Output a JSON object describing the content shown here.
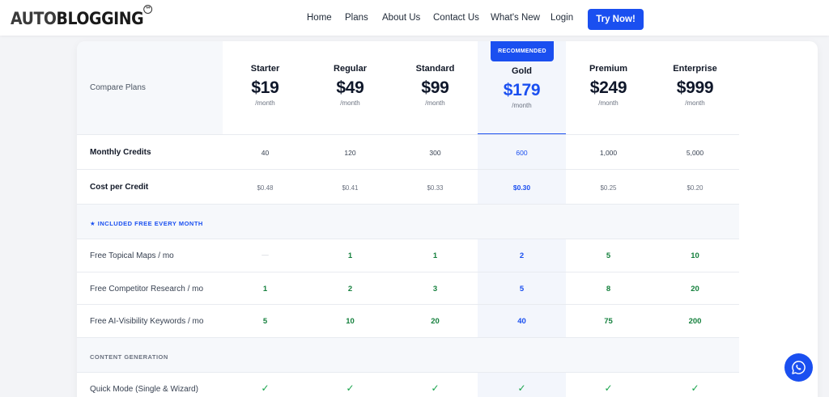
{
  "header": {
    "logo_auto": "AUTO",
    "logo_blogging": "BLOGGING",
    "logo_tm": "TM",
    "nav": [
      "Home",
      "Plans",
      "About Us",
      "Contact Us",
      "What's New",
      "Login"
    ],
    "cta": "Try Now!"
  },
  "table": {
    "compare_label": "Compare Plans",
    "badge": "RECOMMENDED",
    "plans": [
      {
        "name": "Starter",
        "price": "$19",
        "per": "/month"
      },
      {
        "name": "Regular",
        "price": "$49",
        "per": "/month"
      },
      {
        "name": "Standard",
        "price": "$99",
        "per": "/month"
      },
      {
        "name": "Gold",
        "price": "$179",
        "per": "/month"
      },
      {
        "name": "Premium",
        "price": "$249",
        "per": "/month"
      },
      {
        "name": "Enterprise",
        "price": "$999",
        "per": "/month"
      }
    ],
    "rows": {
      "credits": {
        "label": "Monthly Credits",
        "values": [
          "40",
          "120",
          "300",
          "600",
          "1,000",
          "5,000"
        ]
      },
      "cost": {
        "label": "Cost per Credit",
        "values": [
          "$0.48",
          "$0.41",
          "$0.33",
          "$0.30",
          "$0.25",
          "$0.20"
        ]
      },
      "section_free": {
        "label": "★ INCLUDED FREE EVERY MONTH"
      },
      "topical": {
        "label": "Free Topical Maps / mo",
        "values": [
          "—",
          "1",
          "1",
          "2",
          "5",
          "10"
        ]
      },
      "competitor": {
        "label": "Free Competitor Research / mo",
        "values": [
          "1",
          "2",
          "3",
          "5",
          "8",
          "20"
        ]
      },
      "visibility": {
        "label": "Free AI-Visibility Keywords / mo",
        "values": [
          "5",
          "10",
          "20",
          "40",
          "75",
          "200"
        ]
      },
      "section_content": {
        "label": "CONTENT GENERATION"
      },
      "quick": {
        "label": "Quick Mode (Single & Wizard)",
        "values": [
          "✓",
          "✓",
          "✓",
          "✓",
          "✓",
          "✓"
        ]
      }
    }
  },
  "icons": {
    "whatsapp": "whatsapp-icon"
  },
  "colors": {
    "accent": "#1a4ff0",
    "green": "#15803d"
  }
}
